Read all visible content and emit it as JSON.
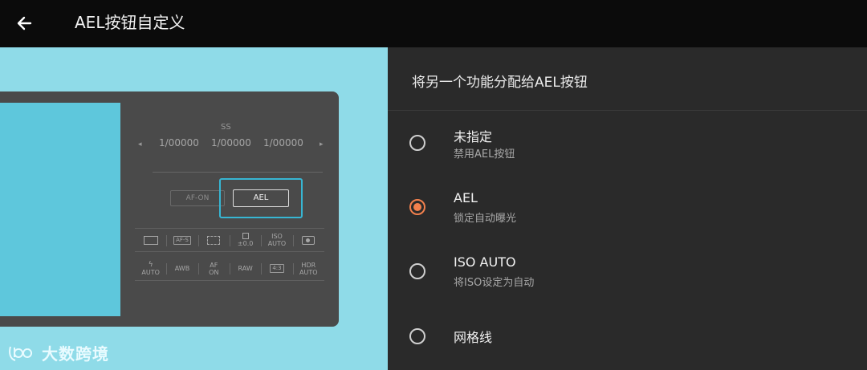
{
  "header": {
    "title": "AEL按钮自定义",
    "back_icon": "arrow-left-icon"
  },
  "preview": {
    "ss_label": "SS",
    "ss_values": [
      "1/00000",
      "1/00000",
      "1/00000"
    ],
    "af_on_label": "AF-ON",
    "ael_label": "AEL",
    "row1": [
      "",
      "AF-S",
      "",
      "±0.0",
      "ISO AUTO",
      ""
    ],
    "row2": [
      "AUTO",
      "AWB",
      "AF ON",
      "RAW",
      "4:3",
      "HDR AUTO"
    ],
    "watermark_text": "大数跨境",
    "colors": {
      "background": "#8fdbe8",
      "viewfinder": "#5ec7dc",
      "highlight": "#37b6d3"
    }
  },
  "settings": {
    "header": "将另一个功能分配给AEL按钮",
    "accent": "#f2804d",
    "options": [
      {
        "title": "未指定",
        "subtitle": "禁用AEL按钮",
        "selected": false
      },
      {
        "title": "AEL",
        "subtitle": "锁定自动曝光",
        "selected": true
      },
      {
        "title": "ISO AUTO",
        "subtitle": "将ISO设定为自动",
        "selected": false
      },
      {
        "title": "网格线",
        "subtitle": "",
        "selected": false
      }
    ]
  }
}
